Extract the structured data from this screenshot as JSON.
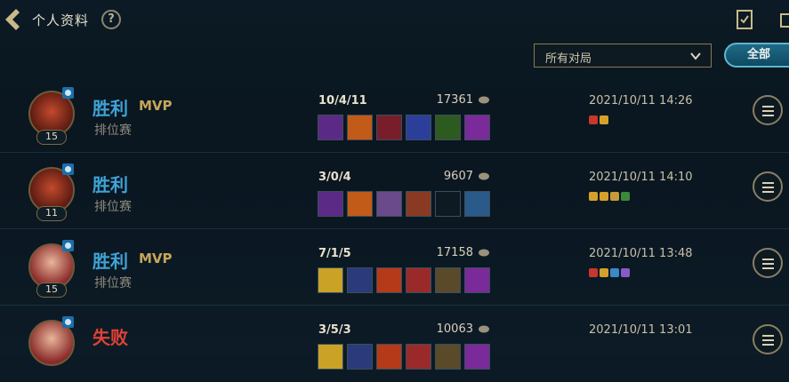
{
  "header": {
    "title": "个人资料",
    "help": "?"
  },
  "filter": {
    "selected": "所有对局",
    "all_label": "全部"
  },
  "matches": [
    {
      "result": "胜利",
      "mvp": "MVP",
      "mode": "排位赛",
      "level": "15",
      "kda": "10/4/11",
      "gold": "17361",
      "time": "2021/10/11 14:26"
    },
    {
      "result": "胜利",
      "mvp": "",
      "mode": "排位赛",
      "level": "11",
      "kda": "3/0/4",
      "gold": "9607",
      "time": "2021/10/11 14:10"
    },
    {
      "result": "胜利",
      "mvp": "MVP",
      "mode": "排位赛",
      "level": "15",
      "kda": "7/1/5",
      "gold": "17158",
      "time": "2021/10/11 13:48"
    },
    {
      "result": "失败",
      "mvp": "",
      "mode": "",
      "level": "",
      "kda": "3/5/3",
      "gold": "10063",
      "time": "2021/10/11 13:01"
    }
  ],
  "colors": {
    "win": "#3fa3d6",
    "loss": "#e04236",
    "mvp": "#c7a55b",
    "accent": "#5fb6cf"
  }
}
